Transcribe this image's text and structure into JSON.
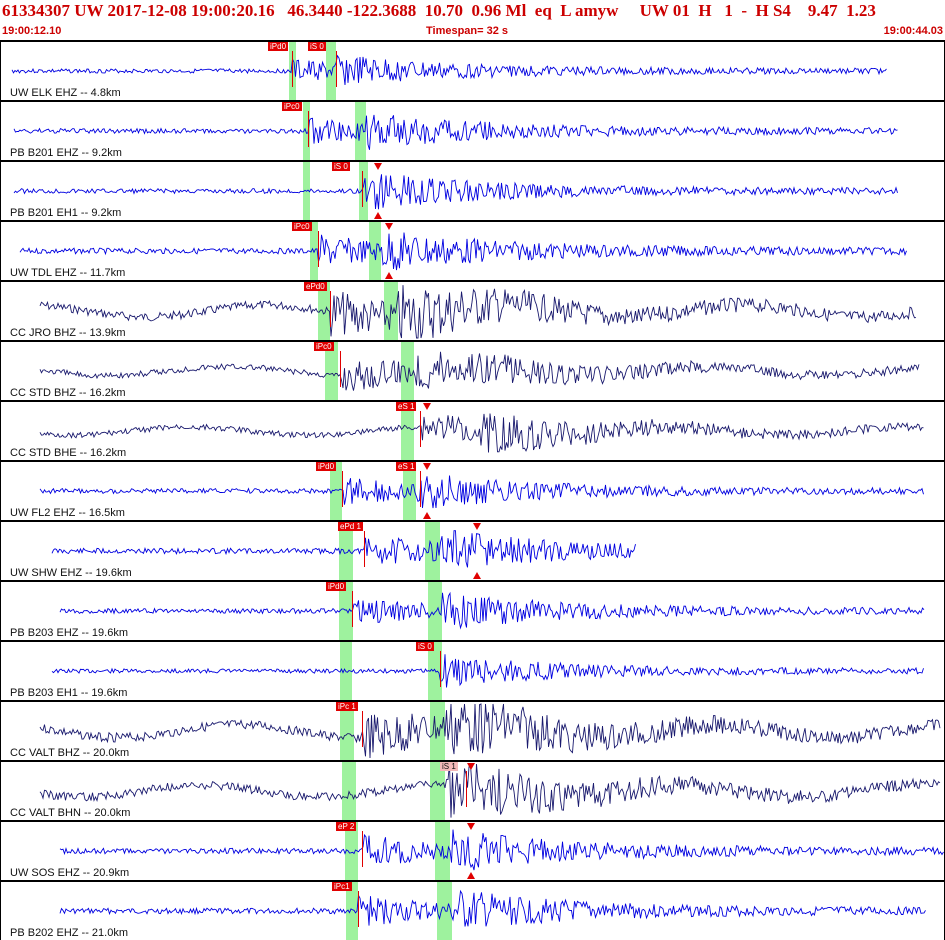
{
  "header": {
    "line": "61334307 UW 2017-12-08 19:00:20.16   46.3440 -122.3688  10.70  0.96 Ml  eq  L amyw     UW 01  H   1  -  H S4    9.47  1.23",
    "start_time": "19:00:12.10",
    "timespan": "Timespan=  32 s",
    "end_time": "19:00:44.03"
  },
  "colors": {
    "pick": "#e00000",
    "band": "#9ef29e",
    "trace_blue": "#0000e0",
    "trace_navy": "#1a1a6e",
    "header": "#cc0000"
  },
  "traces": [
    {
      "label": "UW ELK EHZ -- 4.8km",
      "picks": [
        "iPd0",
        "iS 0"
      ]
    },
    {
      "label": "PB B201 EHZ -- 9.2km",
      "picks": [
        "iPc0"
      ]
    },
    {
      "label": "PB B201 EH1 -- 9.2km",
      "picks": [
        "iS 0"
      ]
    },
    {
      "label": "UW TDL EHZ -- 11.7km",
      "picks": [
        "iPc0"
      ]
    },
    {
      "label": "CC JRO BHZ -- 13.9km",
      "picks": [
        "ePd0"
      ]
    },
    {
      "label": "CC STD BHZ -- 16.2km",
      "picks": [
        "iPc0"
      ]
    },
    {
      "label": "CC STD BHE -- 16.2km",
      "picks": [
        "eS 1"
      ]
    },
    {
      "label": "UW FL2 EHZ -- 16.5km",
      "picks": [
        "iPd0",
        "eS 1"
      ]
    },
    {
      "label": "UW SHW EHZ -- 19.6km",
      "picks": [
        "ePd 1"
      ]
    },
    {
      "label": "PB B203 EHZ -- 19.6km",
      "picks": [
        "iPd0"
      ]
    },
    {
      "label": "PB B203 EH1 -- 19.6km",
      "picks": [
        "iS 0"
      ]
    },
    {
      "label": "CC VALT BHZ -- 20.0km",
      "picks": [
        "iPc 1"
      ]
    },
    {
      "label": "CC VALT BHN -- 20.0km",
      "picks": [
        "iS 1"
      ]
    },
    {
      "label": "UW SOS EHZ -- 20.9km",
      "picks": [
        "eP 2"
      ]
    },
    {
      "label": "PB B202 EHZ -- 21.0km",
      "picks": [
        "iPc1"
      ]
    }
  ]
}
